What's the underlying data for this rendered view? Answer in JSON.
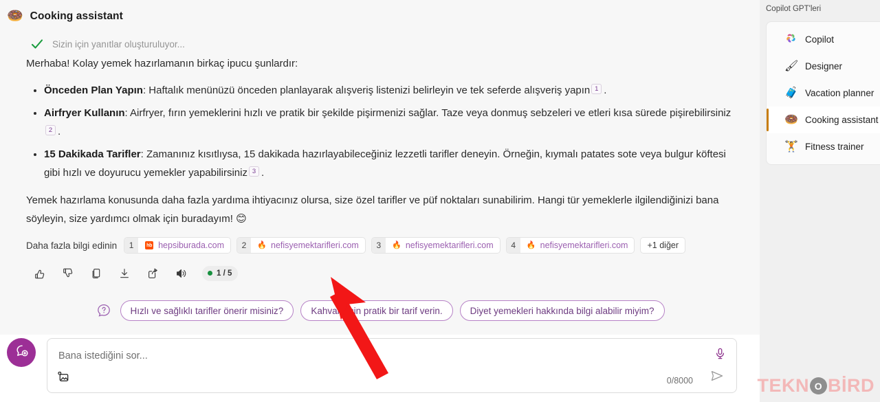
{
  "agent": {
    "emoji": "🍩",
    "title": "Cooking assistant",
    "status": "Sizin için yanıtlar oluşturuluyor...",
    "check_icon": "green-check-icon"
  },
  "message": {
    "intro": "Merhaba! Kolay yemek hazırlamanın birkaç ipucu şunlardır:",
    "tips": [
      {
        "bold": "Önceden Plan Yapın",
        "text": ": Haftalık menünüzü önceden planlayarak alışveriş listenizi belirleyin ve tek seferde alışveriş yapın",
        "cite": "1",
        "tail": "."
      },
      {
        "bold": "Airfryer Kullanın",
        "text": ": Airfryer, fırın yemeklerini hızlı ve pratik bir şekilde pişirmenizi sağlar. Taze veya donmuş sebzeleri ve etleri kısa sürede pişirebilirsiniz",
        "cite": "2",
        "tail": "."
      },
      {
        "bold": "15 Dakikada Tarifler",
        "text": ": Zamanınız kısıtlıysa, 15 dakikada hazırlayabileceğiniz lezzetli tarifler deneyin. Örneğin, kıymalı patates sote veya bulgur köftesi gibi hızlı ve doyurucu yemekler yapabilirsiniz",
        "cite": "3",
        "tail": "."
      }
    ],
    "closing": "Yemek hazırlama konusunda daha fazla yardıma ihtiyacınız olursa, size özel tarifler ve püf noktaları sunabilirim. Hangi tür yemeklerle ilgilendiğinizi bana söyleyin, size yardımcı olmak için buradayım! 😊"
  },
  "sources": {
    "label": "Daha fazla bilgi edinin",
    "items": [
      {
        "num": "1",
        "domain": "hepsiburada.com",
        "favicon": "hepsiburada-favicon"
      },
      {
        "num": "2",
        "domain": "nefisyemektarifleri.com",
        "favicon": "nefisyemektarifleri-favicon"
      },
      {
        "num": "3",
        "domain": "nefisyemektarifleri.com",
        "favicon": "nefisyemektarifleri-favicon"
      },
      {
        "num": "4",
        "domain": "nefisyemektarifleri.com",
        "favicon": "nefisyemektarifleri-favicon"
      }
    ],
    "more_label": "+1 diğer"
  },
  "actions": {
    "icons": [
      "thumbs-up-icon",
      "thumbs-down-icon",
      "copy-icon",
      "download-icon",
      "share-icon",
      "speaker-icon"
    ],
    "pager_label": "1 / 5",
    "pager_dot_color": "#17903f"
  },
  "suggestions": {
    "help_icon": "question-mark-icon",
    "chips": [
      "Hızlı ve sağlıklı tarifler önerir misiniz?",
      "Kahvaltı için pratik bir tarif verin.",
      "Diyet yemekleri hakkında bilgi alabilir miyim?"
    ]
  },
  "composer": {
    "new_chat_icon": "new-chat-icon",
    "placeholder": "Bana istediğini sor...",
    "attach_icon": "add-image-icon",
    "mic_icon": "microphone-icon",
    "counter": "0/8000",
    "send_icon": "send-icon"
  },
  "sidebar": {
    "title": "Copilot GPT'leri",
    "items": [
      {
        "label": "Copilot",
        "icon": "copilot-logo-icon",
        "selected": false
      },
      {
        "label": "Designer",
        "icon": "designer-brush-icon",
        "emoji": "🖌",
        "selected": false
      },
      {
        "label": "Vacation planner",
        "icon": "suitcase-icon",
        "emoji": "🧳",
        "selected": false
      },
      {
        "label": "Cooking assistant",
        "icon": "donut-icon",
        "emoji": "🍩",
        "selected": true
      },
      {
        "label": "Fitness trainer",
        "icon": "dumbbell-icon",
        "emoji": "🏋",
        "selected": false
      }
    ],
    "accent_color": "#c77d0e"
  },
  "watermark": {
    "part1": "TEKN",
    "part2": "BİRD",
    "o_letter": "O",
    "color": "#f3b8b8"
  },
  "annotation": {
    "arrow_color": "#f21717"
  }
}
